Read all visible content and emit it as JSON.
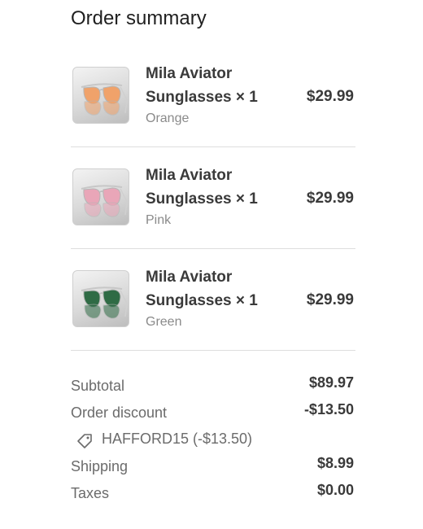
{
  "header": {
    "title": "Order summary"
  },
  "items": [
    {
      "name": "Mila Aviator Sunglasses × 1",
      "variant": "Orange",
      "price": "$29.99",
      "lens_color": "#f0a26a",
      "icon": "sunglasses-thumbnail"
    },
    {
      "name": "Mila Aviator Sunglasses × 1",
      "variant": "Pink",
      "price": "$29.99",
      "lens_color": "#e9a6b8",
      "icon": "sunglasses-thumbnail"
    },
    {
      "name": "Mila Aviator Sunglasses × 1",
      "variant": "Green",
      "price": "$29.99",
      "lens_color": "#2f6b45",
      "icon": "sunglasses-thumbnail"
    }
  ],
  "totals": {
    "subtotal_label": "Subtotal",
    "subtotal_value": "$89.97",
    "discount_label": "Order discount",
    "discount_value": "-$13.50",
    "discount_code": "HAFFORD15 (-$13.50)",
    "discount_icon": "tag-icon",
    "shipping_label": "Shipping",
    "shipping_value": "$8.99",
    "taxes_label": "Taxes",
    "taxes_value": "$0.00"
  }
}
